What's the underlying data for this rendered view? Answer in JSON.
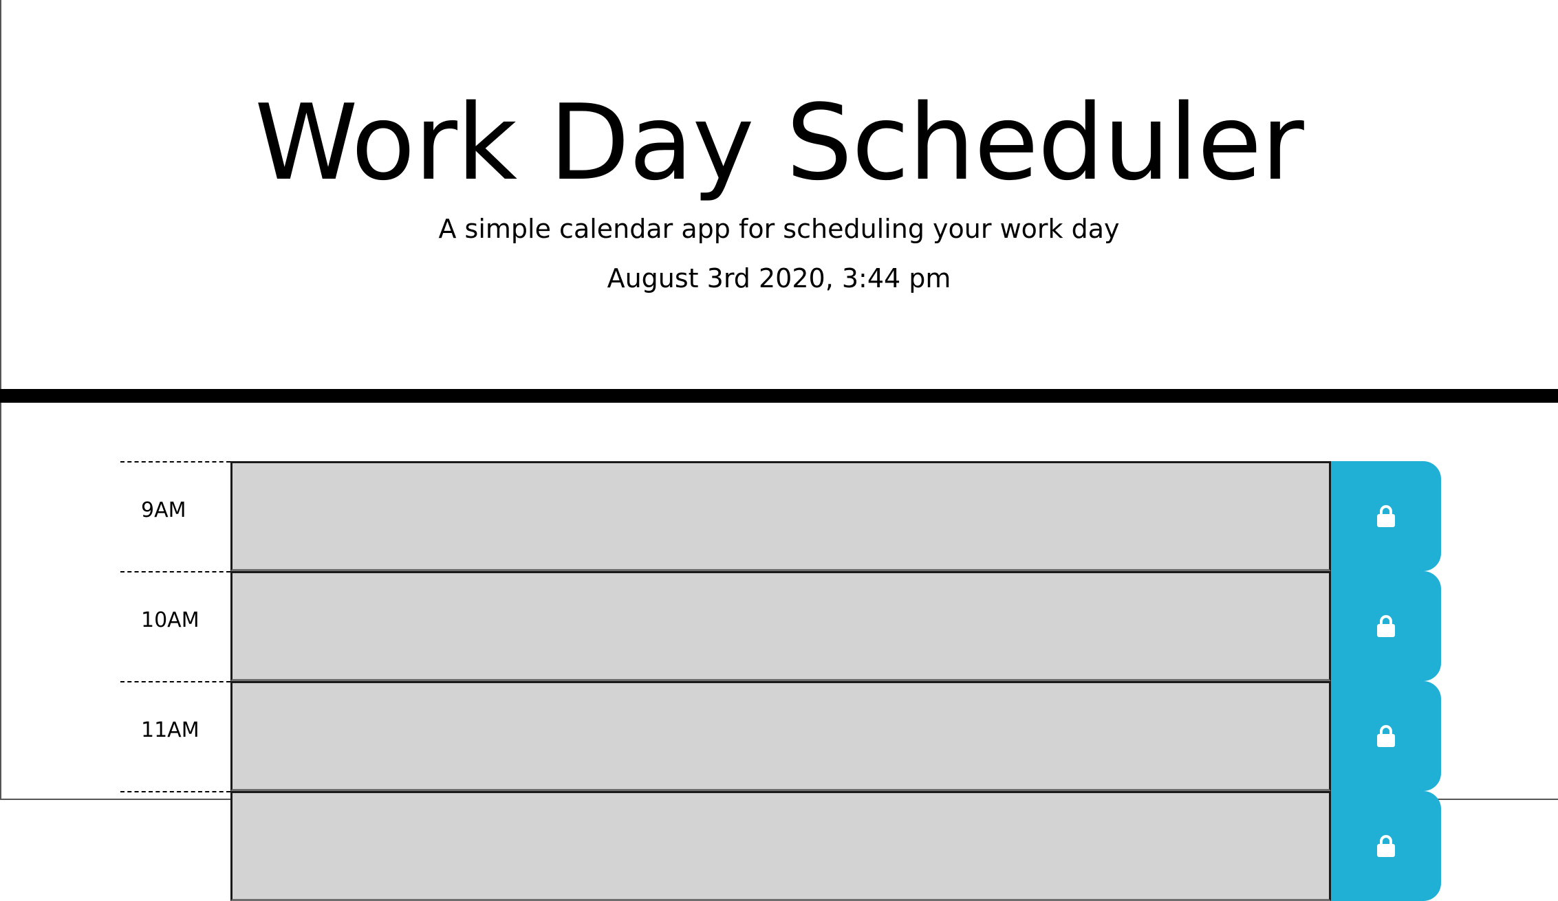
{
  "header": {
    "title": "Work Day Scheduler",
    "subtitle": "A simple calendar app for scheduling your work day",
    "current_day": "August 3rd 2020, 3:44 pm"
  },
  "schedule": {
    "rows": [
      {
        "hour": "9AM",
        "text": "",
        "status": "past",
        "save_icon": "lock-icon"
      },
      {
        "hour": "10AM",
        "text": "",
        "status": "past",
        "save_icon": "lock-icon"
      },
      {
        "hour": "11AM",
        "text": "",
        "status": "past",
        "save_icon": "lock-icon"
      },
      {
        "hour": "",
        "text": "",
        "status": "past",
        "save_icon": "lock-icon"
      }
    ]
  },
  "colors": {
    "past": "#d3d3d3",
    "save_button": "#20b0d6",
    "header_rule": "#000000"
  }
}
